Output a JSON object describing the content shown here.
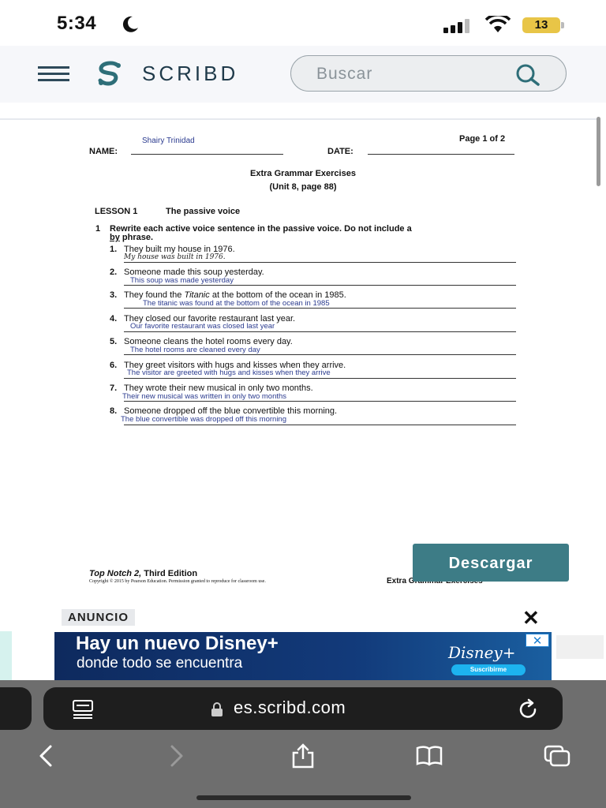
{
  "status_bar": {
    "time": "5:34",
    "battery": "13"
  },
  "header": {
    "logo": "SCRIBD",
    "search_placeholder": "Buscar"
  },
  "document": {
    "student_name": "Shairy Trinidad",
    "page_indicator": "Page 1 of 2",
    "name_label": "NAME:",
    "date_label": "DATE:",
    "title": "Extra Grammar Exercises",
    "subtitle": "(Unit 8, page 88)",
    "lesson_label": "LESSON 1",
    "lesson_title": "The passive voice",
    "instruction_number": "1",
    "instruction_line1": "Rewrite each active voice sentence in the passive voice. Do not include a",
    "instruction_by": "by",
    "instruction_line2": " phrase.",
    "items": [
      {
        "num": "1.",
        "prompt": "They built my house in 1976.",
        "answer": "My house was built in 1976."
      },
      {
        "num": "2.",
        "prompt": "Someone made this soup yesterday.",
        "answer": "This soup was made yesterday"
      },
      {
        "num": "3.",
        "prompt_before": "They found the ",
        "prompt_italic": "Titanic",
        "prompt_after": " at the bottom of the ocean in 1985.",
        "answer": "The titanic was found at the bottom of the ocean in 1985"
      },
      {
        "num": "4.",
        "prompt": "They closed our favorite restaurant last year.",
        "answer": "Our favorite restaurant was closed last year"
      },
      {
        "num": "5.",
        "prompt": "Someone cleans the hotel rooms every day.",
        "answer": "The hotel rooms are cleaned every day"
      },
      {
        "num": "6.",
        "prompt": "They greet visitors with hugs and kisses when they arrive.",
        "answer": "The visitor are greeted with hugs and kisses when they arrive"
      },
      {
        "num": "7.",
        "prompt": "They wrote their new musical in only two months.",
        "answer": "Their new musical was written in only two months"
      },
      {
        "num": "8.",
        "prompt": "Someone dropped off the blue convertible this morning.",
        "answer": "The blue convertible was dropped off this morning"
      }
    ],
    "footer_book": "Top Notch 2,",
    "footer_edition": " Third Edition",
    "footer_copyright": "Copyright © 2015 by Pearson Education. Permission granted to reproduce for classroom use.",
    "footer_right": "Extra Grammar Exercises"
  },
  "download_button": "Descargar",
  "ad": {
    "label": "ANUNCIO",
    "close": "✕",
    "title": "Hay un nuevo Disney+",
    "subtitle": "donde todo se encuentra",
    "brand": "Disney+",
    "cta": "Suscribirme",
    "x_mark": "✕"
  },
  "browser": {
    "url": "es.scribd.com"
  },
  "icons": [
    "moon-icon",
    "signal-icon",
    "wifi-icon",
    "menu-icon",
    "scribd-logo-icon",
    "search-icon",
    "lock-icon",
    "reader-icon",
    "reload-icon",
    "back-icon",
    "forward-icon",
    "share-icon",
    "bookmarks-icon",
    "tabs-icon"
  ],
  "colors": {
    "accent": "#3d7c86",
    "brand_text": "#1f3a4a",
    "answer_ink": "#2b3b8f",
    "ad_bg": "#0e2a5e"
  }
}
